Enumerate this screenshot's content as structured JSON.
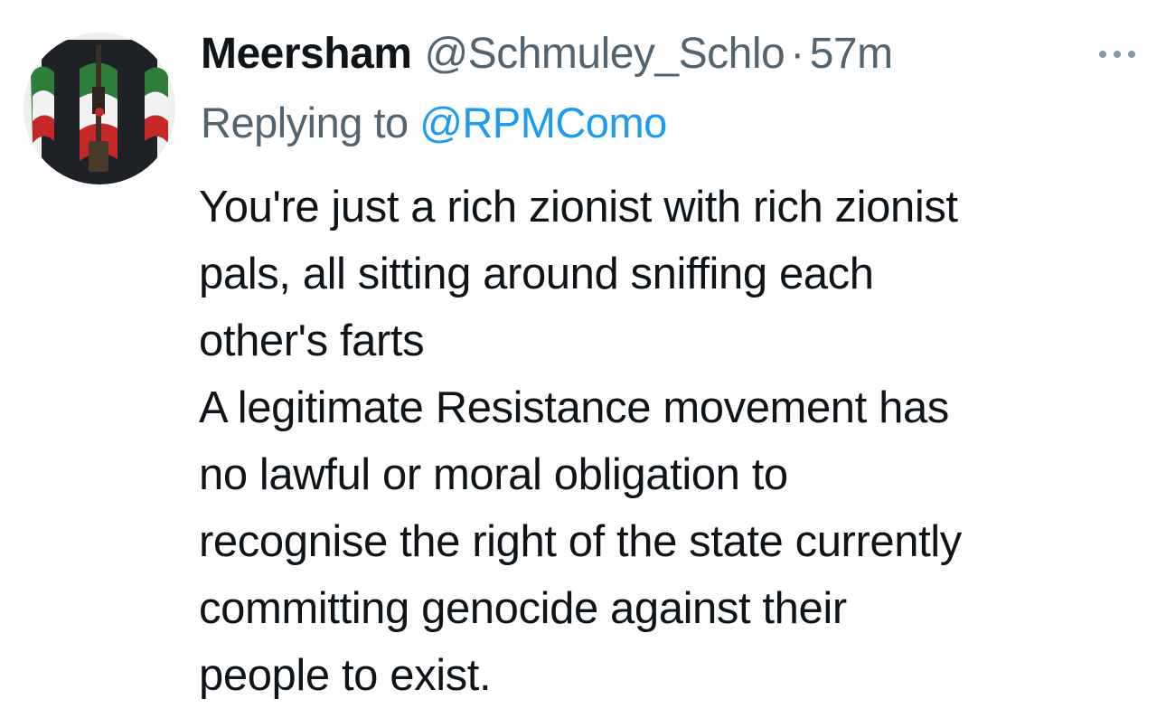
{
  "tweet": {
    "display_name": "Meersham",
    "handle": "@Schmuley_Schlo",
    "separator": "·",
    "timestamp": "57m",
    "more_icon": "more-horizontal-icon",
    "reply_prefix": "Replying to",
    "reply_to_handle": "@RPMComo",
    "body_lines": [
      "You're just a rich zionist with rich zionist",
      "pals, all sitting around sniffing each",
      "other's farts",
      "A legitimate Resistance movement has",
      "no lawful or moral obligation to",
      "recognise the right of the state currently",
      "committing genocide against their",
      "people to exist."
    ]
  },
  "colors": {
    "primary_text": "#0f1419",
    "secondary_text": "#536471",
    "link": "#1d9bf0",
    "background": "#ffffff"
  }
}
